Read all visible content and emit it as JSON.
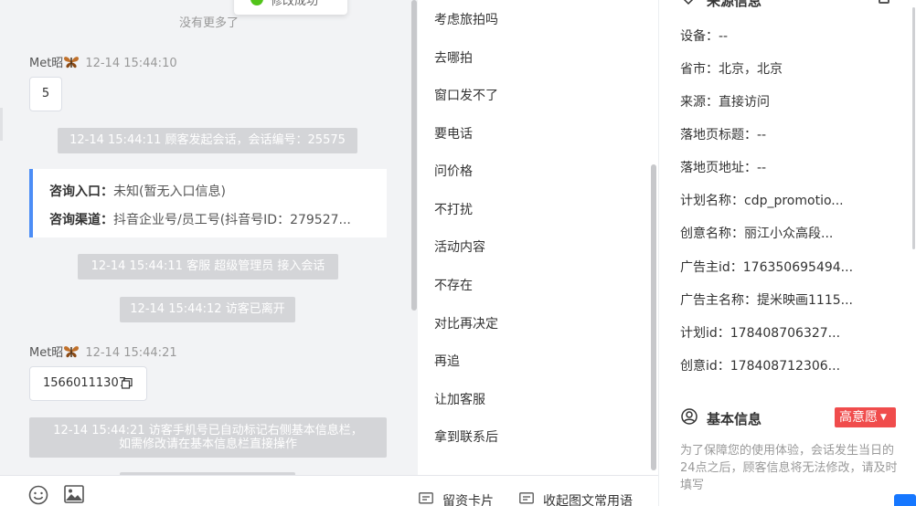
{
  "toast": {
    "text": "修改成功"
  },
  "chat": {
    "no_more": "没有更多了",
    "messages": [
      {
        "sender": "Met昭",
        "time": "12-14 15:44:10",
        "content": "5"
      },
      {
        "sender": "Met昭",
        "time": "12-14 15:44:21",
        "content": "15660111307"
      }
    ],
    "system": [
      "12-14 15:44:11 顾客发起会话，会话编号：25575",
      "12-14 15:44:11 客服 超级管理员 接入会话",
      "12-14 15:44:12 访客已离开",
      "12-14 15:44:21 访客手机号已自动标记右侧基本信息栏，",
      "如需修改请在基本信息栏直接操作"
    ],
    "consult": {
      "entry_label": "咨询入口：",
      "entry_value": "未知(暂无入口信息)",
      "channel_label": "咨询渠道：",
      "channel_value": "抖音企业号/员工号(抖音号ID：279527..."
    }
  },
  "phrases": [
    "考虑旅拍吗",
    "去哪拍",
    "窗口发不了",
    "要电话",
    "问价格",
    "不打扰",
    "活动内容",
    "不存在",
    "对比再决定",
    "再追",
    "让加客服",
    "拿到联系后"
  ],
  "toolbar": {
    "emoji_icon": "emoji-icon",
    "image_icon": "image-icon",
    "card_label": "留资卡片",
    "phrases_label": "收起图文常用语"
  },
  "info": {
    "source_title": "来源信息",
    "rows": [
      "设备：--",
      "省市：北京，北京",
      "来源：直接访问",
      "落地页标题：--",
      "落地页地址：--",
      "计划名称：cdp_promotio...",
      "创意名称：丽江小众高段...",
      "广告主id：176350695494...",
      "广告主名称：提米映画1115...",
      "计划id：178408706327...",
      "创意id：178408712306..."
    ],
    "basic_title": "基本信息",
    "intent": "高意愿",
    "notice": "为了保障您的使用体验，会话发生当日的24点之后，顾客信息将无法修改，请及时填写"
  },
  "colors": {
    "accent": "#4c8df6",
    "intent": "#f04c4c",
    "success": "#52c41a"
  }
}
